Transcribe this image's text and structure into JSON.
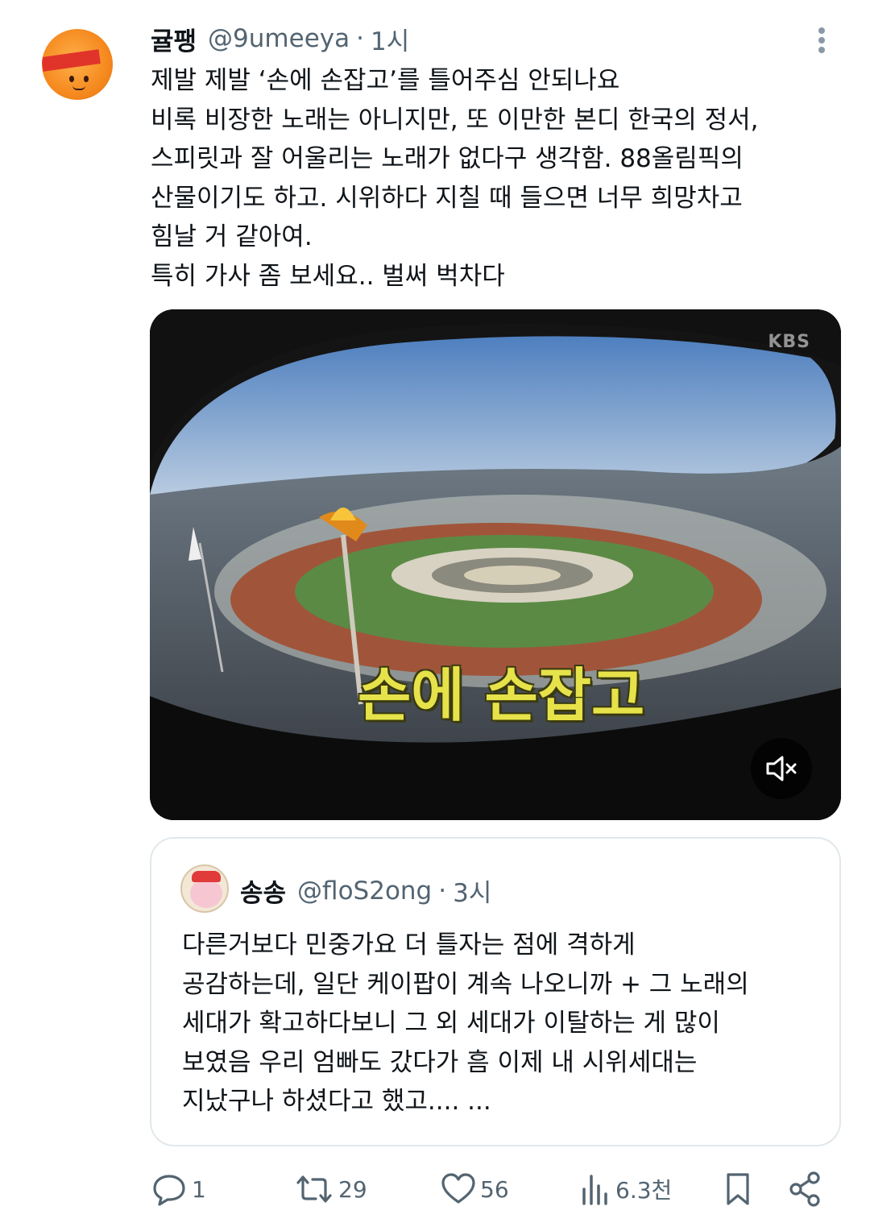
{
  "tweet": {
    "author_name": "귤팽",
    "handle": "@9umeeya",
    "separator": "·",
    "time": "1시",
    "avatar_icon": "tangerine-avatar-icon",
    "text_lines": [
      "제발 제발 ‘손에 손잡고’를 틀어주심 안되나요",
      "비록 비장한 노래는 아니지만, 또 이만한 본디 한국의 정서,",
      "스피릿과 잘 어울리는 노래가 없다구 생각함. 88올림픽의",
      "산물이기도 하고. 시위하다 지칠 때 들으면 너무 희망차고",
      "힘날 거 같아여.",
      "특히 가사 좀 보세요.. 벌써 벅차다"
    ]
  },
  "media": {
    "watermark": "KBS",
    "caption": "손에 손잡고",
    "mute_icon": "speaker-muted-icon"
  },
  "quote": {
    "author_name": "송송",
    "handle": "@floS2ong",
    "separator": "·",
    "time": "3시",
    "text_lines": [
      "다른거보다 민중가요 더 틀자는 점에 격하게",
      "공감하는데, 일단 케이팝이 계속 나오니까 + 그 노래의",
      "세대가 확고하다보니 그 외 세대가 이탈하는 게 많이",
      "보였음 우리 엄빠도 갔다가 흠 이제 내 시위세대는",
      "지났구나 하셨다고 했고.... ..."
    ]
  },
  "actions": {
    "reply_count": "1",
    "retweet_count": "29",
    "like_count": "56",
    "views_count": "6.3천"
  },
  "colors": {
    "text": "#0f1419",
    "secondary": "#536471",
    "border": "#e1e8ed",
    "caption_yellow": "#e6e24a"
  }
}
